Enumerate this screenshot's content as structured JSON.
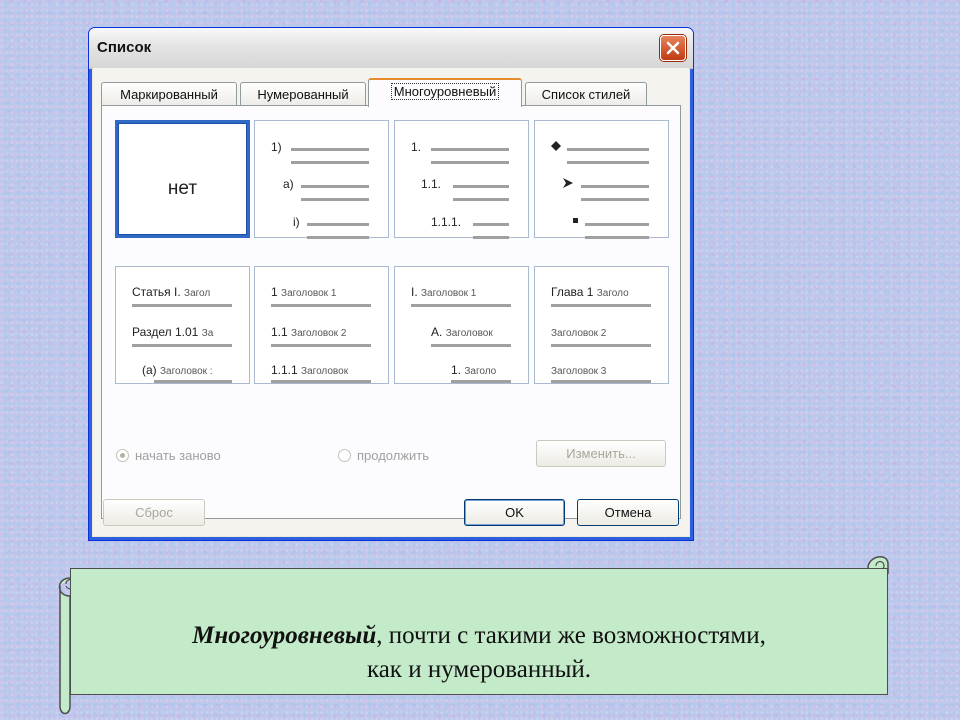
{
  "dialog": {
    "title": "Список",
    "tabs": [
      {
        "label": "Маркированный"
      },
      {
        "label": "Нумерованный"
      },
      {
        "label": "Многоуровневый",
        "active": true
      },
      {
        "label": "Список стилей"
      }
    ],
    "gallery": {
      "none_label": "нет",
      "cell2": [
        "1)",
        "a)",
        "i)"
      ],
      "cell3": [
        "1.",
        "1.1.",
        "1.1.1."
      ],
      "cell4_icons": [
        "diamond-bullet-icon",
        "arrow-bullet-icon",
        "square-bullet-icon"
      ],
      "cell5": [
        {
          "num": "Статья I.",
          "heading": "Загол"
        },
        {
          "num": "Раздел 1.01",
          "heading": "За"
        },
        {
          "num": "(a)",
          "heading": "Заголовок :"
        }
      ],
      "cell6": [
        {
          "num": "1",
          "heading": "Заголовок 1"
        },
        {
          "num": "1.1",
          "heading": "Заголовок 2"
        },
        {
          "num": "1.1.1",
          "heading": "Заголовок"
        }
      ],
      "cell7": [
        {
          "num": "I.",
          "heading": "Заголовок 1"
        },
        {
          "num": "A.",
          "heading": "Заголовок"
        },
        {
          "num": "1.",
          "heading": "Заголо"
        }
      ],
      "cell8": [
        {
          "num": "Глава 1",
          "heading": "Заголо"
        },
        {
          "num": "",
          "heading": "Заголовок 2"
        },
        {
          "num": "",
          "heading": "Заголовок 3"
        }
      ]
    },
    "restart_label": "начать заново",
    "continue_label": "продолжить",
    "modify_label": "Изменить...",
    "reset_label": "Сброс",
    "ok_label": "OK",
    "cancel_label": "Отмена"
  },
  "caption": {
    "bold_italic": "Многоуровневый",
    "line1_rest": ", почти с такими же возможностями,",
    "line2": "как и нумерованный."
  }
}
